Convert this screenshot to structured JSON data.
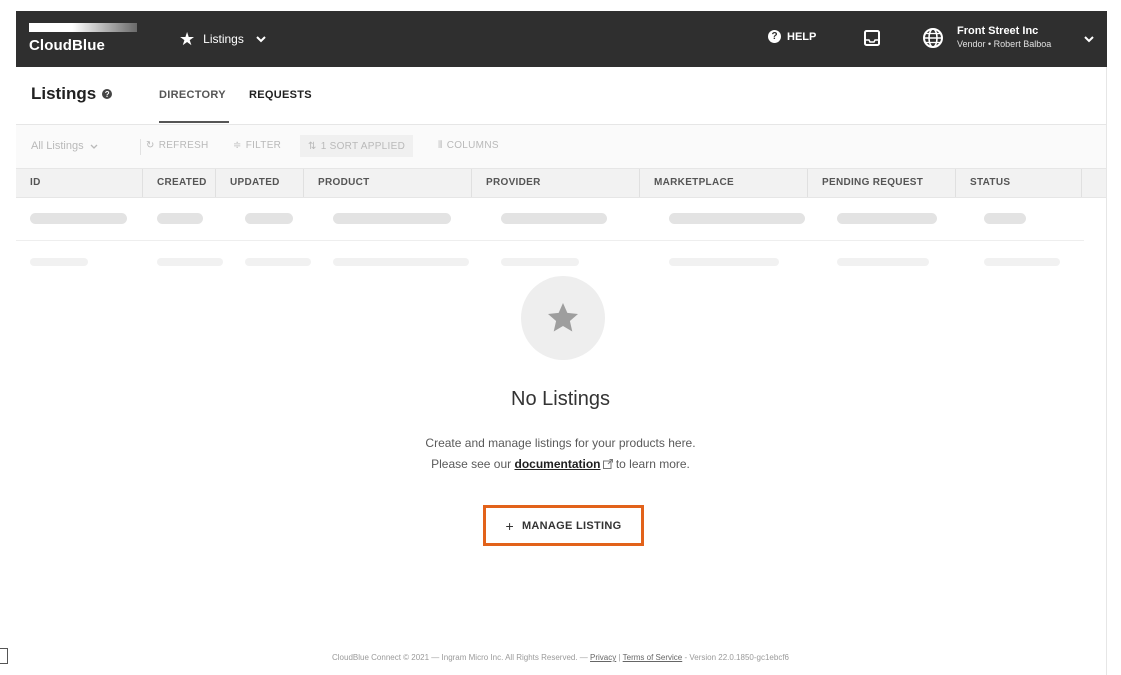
{
  "topbar": {
    "logo_text": "CloudBlue",
    "listings_label": "Listings",
    "help_label": "HELP",
    "account_org": "Front Street Inc",
    "account_user": "Vendor • Robert Balboa"
  },
  "header": {
    "title": "Listings",
    "tabs": [
      {
        "label": "DIRECTORY",
        "active": true
      },
      {
        "label": "REQUESTS",
        "active": false
      }
    ]
  },
  "toolbar": {
    "view_select": "All Listings",
    "refresh": "REFRESH",
    "filter": "FILTER",
    "sort": "1 SORT APPLIED",
    "columns": "COLUMNS"
  },
  "table": {
    "columns": [
      "ID",
      "CREATED",
      "UPDATED",
      "PRODUCT",
      "PROVIDER",
      "MARKETPLACE",
      "PENDING REQUEST",
      "STATUS"
    ]
  },
  "empty_state": {
    "title": "No Listings",
    "line1": "Create and manage listings for your products here.",
    "line2_prefix": "Please see our",
    "link_text": "documentation",
    "line2_suffix": "to learn more.",
    "button_label": "MANAGE LISTING"
  },
  "footer": {
    "prefix": "CloudBlue Connect © 2021 — Ingram Micro Inc. All Rights Reserved. —",
    "privacy": "Privacy",
    "sep": "|",
    "terms": "Terms of Service",
    "version": "- Version 22.0.1850-gc1ebcf6"
  },
  "colors": {
    "topbar_bg": "#2f2f2f",
    "highlight_border": "#e2621a"
  }
}
